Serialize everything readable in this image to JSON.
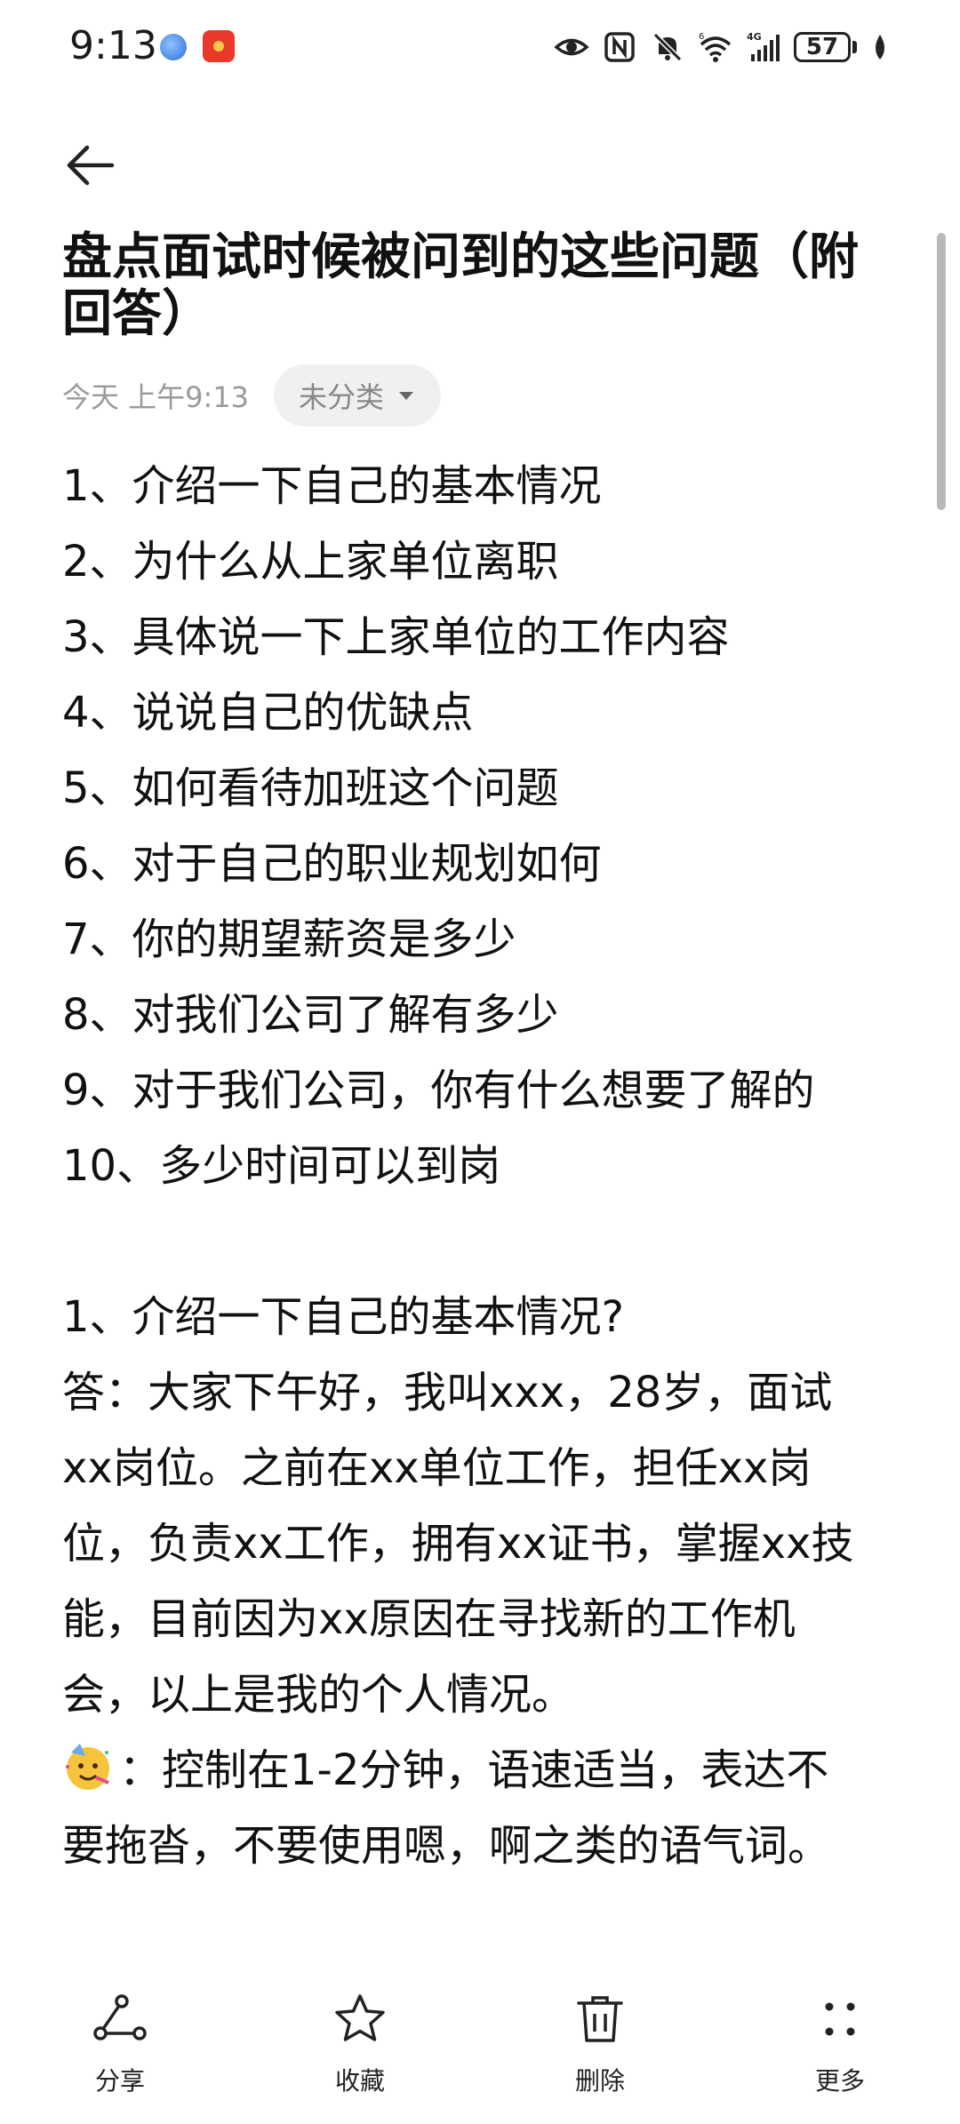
{
  "status_bar": {
    "time": "9:13",
    "battery": "57",
    "network": "4G",
    "wifi_badge": "6"
  },
  "note": {
    "title": "盘点面试时候被问到的这些问题（附回答）",
    "date": "今天 上午9:13",
    "category": "未分类"
  },
  "questions": [
    "1、介绍一下自己的基本情况",
    "2、为什么从上家单位离职",
    "3、具体说一下上家单位的工作内容",
    "4、说说自己的优缺点",
    "5、如何看待加班这个问题",
    "6、对于自己的职业规划如何",
    "7、你的期望薪资是多少",
    "8、对我们公司了解有多少",
    "9、对于我们公司，你有什么想要了解的",
    "10、多少时间可以到岗"
  ],
  "answer_section": {
    "heading": "1、介绍一下自己的基本情况?",
    "lines": [
      "答：大家下午好，我叫xxx，28岁，面试",
      "xx岗位。之前在xx单位工作，担任xx岗",
      "位，负责xx工作，拥有xx证书，掌握xx技",
      "能，目前因为xx原因在寻找新的工作机",
      "会，以上是我的个人情况。"
    ],
    "tip_lines": [
      "：控制在1-2分钟，语速适当，表达不",
      "要拖沓，不要使用嗯，啊之类的语气词。"
    ]
  },
  "bottom_bar": {
    "share": "分享",
    "favorite": "收藏",
    "delete": "删除",
    "more": "更多"
  }
}
